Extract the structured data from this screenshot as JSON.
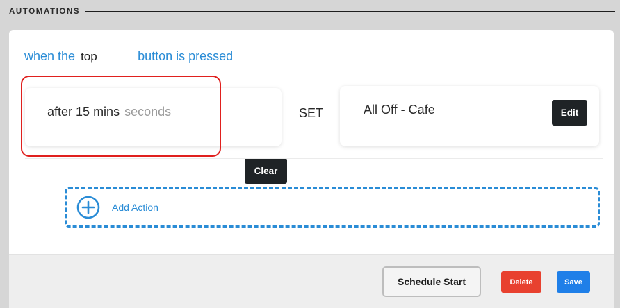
{
  "section": {
    "title": "AUTOMATIONS"
  },
  "trigger": {
    "prefix": "when the",
    "button_value": "top",
    "suffix": "button is pressed"
  },
  "delay": {
    "prefix": "after",
    "value": "15",
    "unit": "mins",
    "unit_hint": "seconds",
    "clear_label": "Clear"
  },
  "action": {
    "verb": "SET",
    "scene_name": "All Off - Cafe",
    "edit_label": "Edit"
  },
  "add_action": {
    "label": "Add Action",
    "icon": "plus-circle-icon"
  },
  "footer": {
    "schedule_start_label": "Schedule Start",
    "delete_label": "Delete",
    "save_label": "Save"
  },
  "colors": {
    "accent": "#2a8cd6",
    "delete": "#e8412f",
    "save": "#1f7fe8",
    "highlight": "#e0201e",
    "dark_button": "#1f2326"
  }
}
